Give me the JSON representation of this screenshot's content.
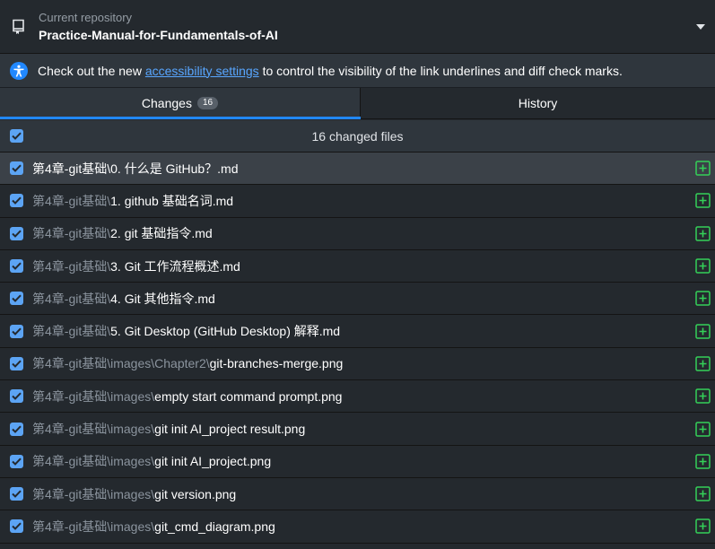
{
  "repo": {
    "label": "Current repository",
    "name": "Practice-Manual-for-Fundamentals-of-AI"
  },
  "banner": {
    "prefix": "Check out the new ",
    "link": "accessibility settings",
    "suffix": " to control the visibility of the link underlines and diff check marks."
  },
  "tabs": {
    "changes_label": "Changes",
    "changes_count": "16",
    "history_label": "History"
  },
  "summary": {
    "text": "16 changed files",
    "all_checked": true
  },
  "files": [
    {
      "dir": "第4章-git基础\\",
      "name": "0. 什么是 GitHub？.md",
      "checked": true,
      "status": "added",
      "selected": true
    },
    {
      "dir": "第4章-git基础\\",
      "name": "1. github 基础名词.md",
      "checked": true,
      "status": "added",
      "selected": false
    },
    {
      "dir": "第4章-git基础\\",
      "name": "2. git 基础指令.md",
      "checked": true,
      "status": "added",
      "selected": false
    },
    {
      "dir": "第4章-git基础\\",
      "name": "3. Git 工作流程概述.md",
      "checked": true,
      "status": "added",
      "selected": false
    },
    {
      "dir": "第4章-git基础\\",
      "name": "4. Git 其他指令.md",
      "checked": true,
      "status": "added",
      "selected": false
    },
    {
      "dir": "第4章-git基础\\",
      "name": "5. Git Desktop (GitHub Desktop) 解释.md",
      "checked": true,
      "status": "added",
      "selected": false
    },
    {
      "dir": "第4章-git基础\\images\\Chapter2\\",
      "name": "git-branches-merge.png",
      "checked": true,
      "status": "added",
      "selected": false
    },
    {
      "dir": "第4章-git基础\\images\\",
      "name": "empty start command prompt.png",
      "checked": true,
      "status": "added",
      "selected": false
    },
    {
      "dir": "第4章-git基础\\images\\",
      "name": "git init AI_project result.png",
      "checked": true,
      "status": "added",
      "selected": false
    },
    {
      "dir": "第4章-git基础\\images\\",
      "name": "git init AI_project.png",
      "checked": true,
      "status": "added",
      "selected": false
    },
    {
      "dir": "第4章-git基础\\images\\",
      "name": "git version.png",
      "checked": true,
      "status": "added",
      "selected": false
    },
    {
      "dir": "第4章-git基础\\images\\",
      "name": "git_cmd_diagram.png",
      "checked": true,
      "status": "added",
      "selected": false
    }
  ],
  "colors": {
    "accent": "#2188ff",
    "checkbox": "#5ca4f4",
    "added": "#34d058",
    "link": "#58a6ff"
  },
  "icons": {
    "repo": "repo-icon",
    "caret": "chevron-down-icon",
    "accessibility": "accessibility-icon",
    "check": "check-icon",
    "added": "file-added-icon"
  }
}
